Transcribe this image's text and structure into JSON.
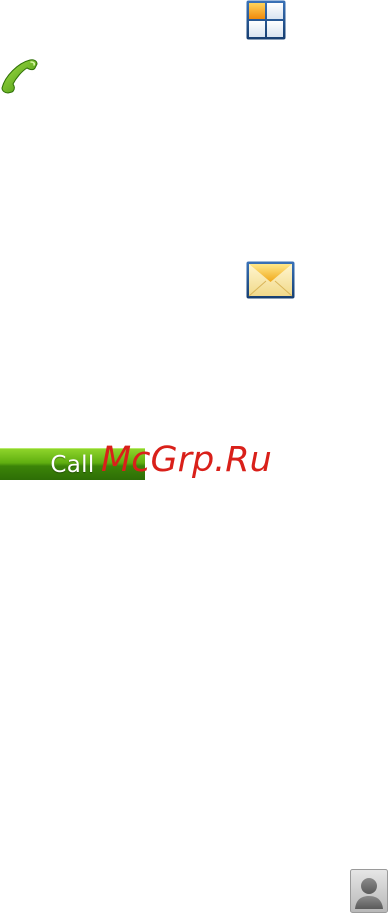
{
  "icons": {
    "apps": "apps-grid-icon",
    "phone": "phone-icon",
    "mail": "envelope-icon",
    "avatar": "contact-avatar-icon"
  },
  "call_button": {
    "label": "Call"
  },
  "watermark": {
    "text": "McGrp.Ru"
  },
  "colors": {
    "call_green": "#3c8408",
    "phone_green": "#5bb51a",
    "watermark_red": "#d9201a",
    "grid_blue": "#1d4f8a",
    "grid_orange": "#f39a12"
  }
}
